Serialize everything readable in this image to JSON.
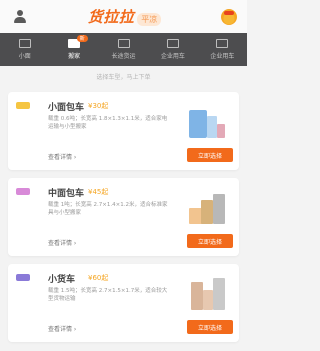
{
  "header": {
    "brand_name": "货拉拉",
    "brand_city": "平凉",
    "user_icon": "user-icon",
    "gift_icon": "gift-icon"
  },
  "tabs": [
    {
      "label": "小面",
      "icon": "van-icon",
      "active": false
    },
    {
      "label": "搬家",
      "icon": "truck-icon",
      "active": true,
      "badge": "新"
    },
    {
      "label": "长途货运",
      "icon": "long-haul-icon",
      "active": false
    },
    {
      "label": "企业用车",
      "icon": "building-icon",
      "active": false
    },
    {
      "label": "企业用车",
      "icon": "company-icon",
      "active": false
    }
  ],
  "hint": "选择车型，马上下单",
  "vehicles": [
    {
      "title": "小面包车",
      "price": "¥30起",
      "desc": "载重 0.6吨；长宽高 1.8×1.3×1.1米，适合家电运输与小型搬家",
      "link": "查看详情",
      "button": "立即选择",
      "flag_color": "#f5c542"
    },
    {
      "title": "中面包车",
      "price": "¥45起",
      "desc": "载重 1吨；长宽高 2.7×1.4×1.2米，适合标准家具与小型搬家",
      "link": "查看详情",
      "button": "立即选择",
      "flag_color": "#d88ad8"
    },
    {
      "title": "小货车",
      "price": "¥60起",
      "desc": "载重 1.5吨；长宽高 2.7×1.5×1.7米，适合较大型货物运输",
      "link": "查看详情",
      "button": "立即选择",
      "flag_color": "#8a7ad8"
    }
  ],
  "colors": {
    "accent": "#f26a1b",
    "tabbar": "#4d4d4f"
  }
}
